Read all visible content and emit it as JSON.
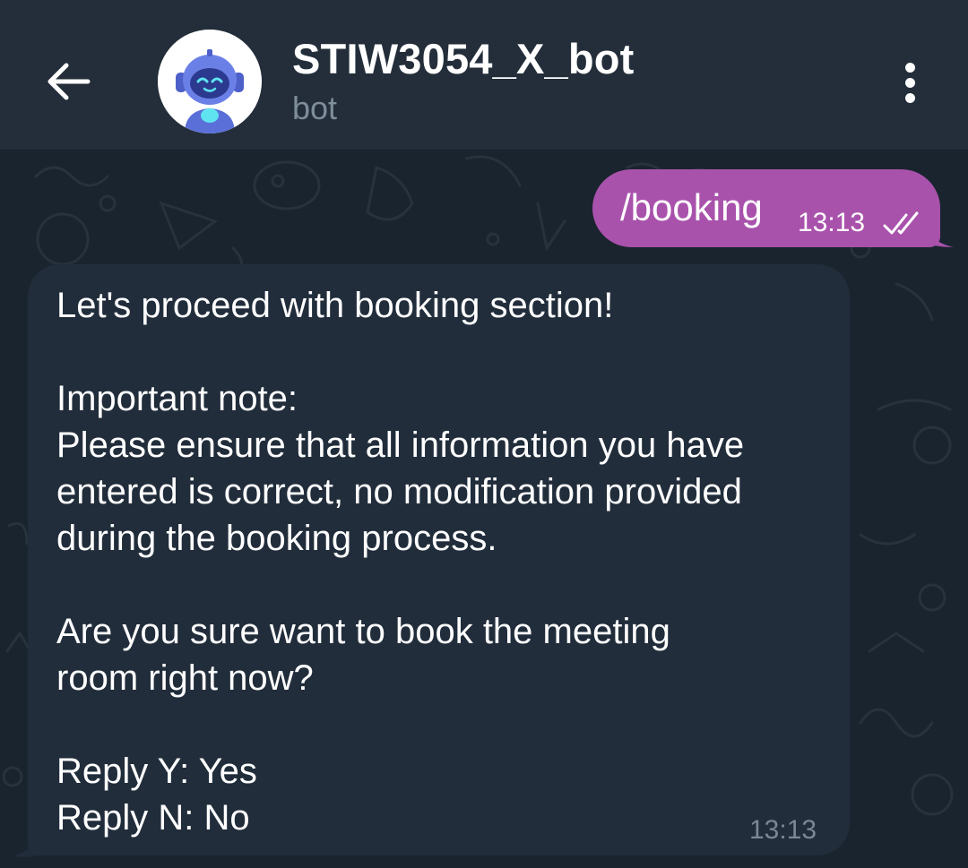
{
  "header": {
    "title": "STIW3054_X_bot",
    "subtitle": "bot",
    "back_icon": "arrow-left-icon",
    "menu_icon": "more-vertical-icon",
    "avatar_icon": "robot-avatar"
  },
  "messages": [
    {
      "direction": "outgoing",
      "text": "/booking",
      "time": "13:13",
      "status_icon": "double-check-icon"
    },
    {
      "direction": "incoming",
      "paragraphs": [
        "Let's proceed with booking section!",
        "",
        "Important note:",
        "Please ensure that all information you have",
        "entered is correct, no modification provided",
        "during the booking process.",
        "",
        "Are you sure want to book the meeting",
        "room right now?",
        "",
        "Reply Y: Yes",
        "Reply N: No"
      ],
      "time": "13:13"
    }
  ],
  "colors": {
    "header_bg": "#232e3a",
    "chat_bg": "#1a242e",
    "outgoing_bubble": "#a952ac",
    "incoming_bubble": "#212d3b",
    "subtitle": "#7f8d9b",
    "timestamp": "#7b8794"
  }
}
